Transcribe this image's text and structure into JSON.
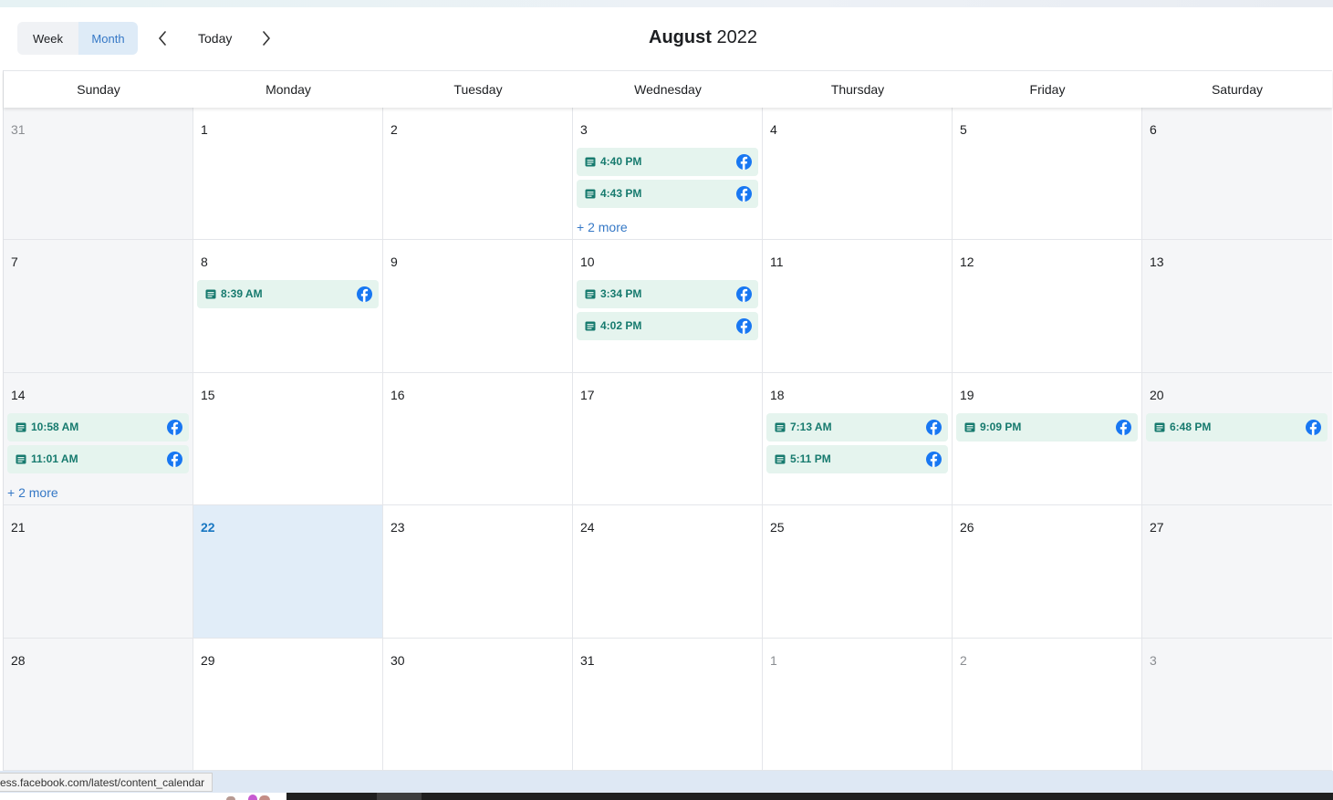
{
  "header": {
    "view_toggle": {
      "week_label": "Week",
      "month_label": "Month",
      "selected": "Month"
    },
    "today_label": "Today",
    "title_month": "August",
    "title_year": "2022"
  },
  "weekdays": [
    "Sunday",
    "Monday",
    "Tuesday",
    "Wednesday",
    "Thursday",
    "Friday",
    "Saturday"
  ],
  "weeks": [
    [
      {
        "day": "31",
        "other_month": true
      },
      {
        "day": "1"
      },
      {
        "day": "2"
      },
      {
        "day": "3",
        "events": [
          "4:40 PM",
          "4:43 PM"
        ],
        "more": "+ 2 more"
      },
      {
        "day": "4"
      },
      {
        "day": "5"
      },
      {
        "day": "6"
      }
    ],
    [
      {
        "day": "7"
      },
      {
        "day": "8",
        "events": [
          "8:39 AM"
        ]
      },
      {
        "day": "9"
      },
      {
        "day": "10",
        "events": [
          "3:34 PM",
          "4:02 PM"
        ]
      },
      {
        "day": "11"
      },
      {
        "day": "12"
      },
      {
        "day": "13"
      }
    ],
    [
      {
        "day": "14",
        "events": [
          "10:58 AM",
          "11:01 AM"
        ],
        "more": "+ 2 more"
      },
      {
        "day": "15"
      },
      {
        "day": "16"
      },
      {
        "day": "17"
      },
      {
        "day": "18",
        "events": [
          "7:13 AM",
          "5:11 PM"
        ]
      },
      {
        "day": "19",
        "events": [
          "9:09 PM"
        ]
      },
      {
        "day": "20",
        "events": [
          "6:48 PM"
        ]
      }
    ],
    [
      {
        "day": "21"
      },
      {
        "day": "22",
        "today": true
      },
      {
        "day": "23"
      },
      {
        "day": "24"
      },
      {
        "day": "25"
      },
      {
        "day": "26"
      },
      {
        "day": "27"
      }
    ],
    [
      {
        "day": "28"
      },
      {
        "day": "29"
      },
      {
        "day": "30"
      },
      {
        "day": "31"
      },
      {
        "day": "1",
        "other_month": true
      },
      {
        "day": "2",
        "other_month": true
      },
      {
        "day": "3",
        "other_month": true
      }
    ]
  ],
  "event_icons": {
    "post": "post-icon",
    "platform": "facebook-icon"
  },
  "status_bar": {
    "url": "ess.facebook.com/latest/content_calendar"
  },
  "colors": {
    "accent": "#3578c6",
    "today_bg": "#e1edf8",
    "today_number": "#1877c2",
    "event_bg": "#e5f4ee",
    "event_text": "#167a6e",
    "facebook_blue": "#1877f2",
    "weekend_bg": "#f5f6f8"
  }
}
